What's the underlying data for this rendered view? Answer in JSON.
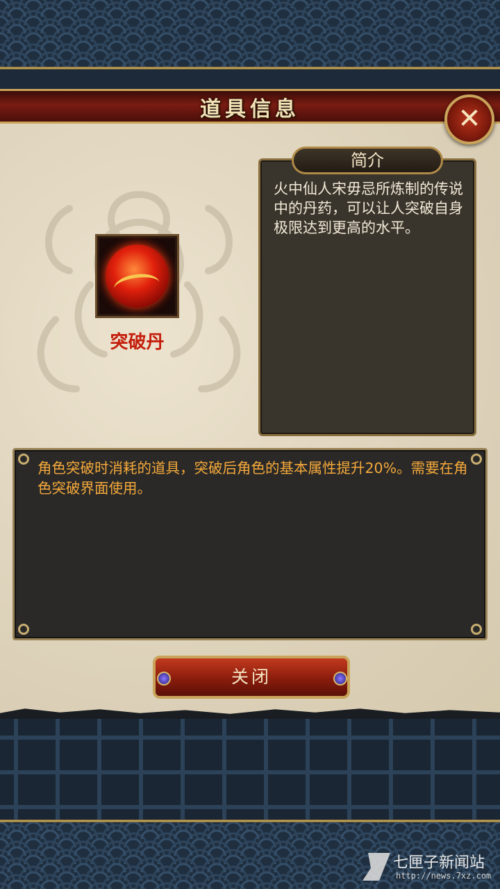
{
  "dialog": {
    "title": "道具信息",
    "close_icon_glyph": "✕"
  },
  "item": {
    "name": "突破丹",
    "icon": "red-orb-pill-icon"
  },
  "intro": {
    "header": "简介",
    "text": "火中仙人宋毋忌所炼制的传说中的丹药，可以让人突破自身极限达到更高的水平。"
  },
  "description": {
    "text": "角色突破时消耗的道具，突破后角色的基本属性提升20%。需要在角色突破界面使用。"
  },
  "buttons": {
    "close_label": "关闭"
  },
  "watermark": {
    "title": "七匣子新闻站",
    "url": "http://news.7xz.com"
  },
  "colors": {
    "panel": "#e2d8c2",
    "title_bar": "#7a1c12",
    "gold": "#c9a35a",
    "desc_text": "#f5a93a",
    "item_name": "#c41e0c"
  }
}
